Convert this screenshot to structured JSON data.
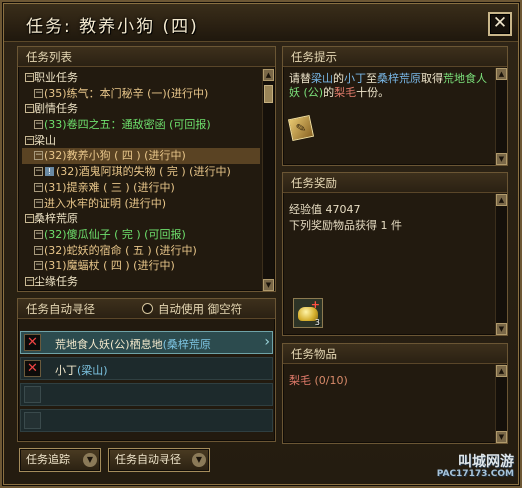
{
  "window": {
    "title": "任务: 教养小狗 (四)",
    "close_label": "✕"
  },
  "quest_list": {
    "header": "任务列表",
    "rows": [
      {
        "kind": "cat",
        "toggle": "−",
        "label": "职业任务"
      },
      {
        "kind": "quest",
        "toggle": "−",
        "label": "(35)练气：本门秘辛 (一)(进行中)",
        "cls": "st-prog"
      },
      {
        "kind": "cat",
        "toggle": "−",
        "label": "剧情任务"
      },
      {
        "kind": "quest",
        "toggle": "−",
        "label": "(33)卷四之五：通敌密函 (可回报)",
        "cls": "st-ret"
      },
      {
        "kind": "cat",
        "toggle": "−",
        "label": "梁山"
      },
      {
        "kind": "quest",
        "toggle": "−",
        "label": "(32)教养小狗 ( 四 ) (进行中)",
        "cls": "st-prog",
        "selected": true
      },
      {
        "kind": "quest",
        "toggle": "−",
        "warn": "!",
        "label": "(32)酒鬼阿琪的失物 ( 完 ) (进行中)",
        "cls": "st-prog"
      },
      {
        "kind": "quest",
        "toggle": "−",
        "label": "(31)提亲难 ( 三 ) (进行中)",
        "cls": "st-prog"
      },
      {
        "kind": "quest",
        "toggle": "−",
        "label": "进入水牢的证明 (进行中)",
        "cls": "st-prog"
      },
      {
        "kind": "cat",
        "toggle": "−",
        "label": "桑梓荒原"
      },
      {
        "kind": "quest",
        "toggle": "−",
        "label": "(32)傻瓜仙子 ( 完 ) (可回报)",
        "cls": "st-ret"
      },
      {
        "kind": "quest",
        "toggle": "−",
        "label": "(32)蛇妖的宿命 ( 五 ) (进行中)",
        "cls": "st-prog"
      },
      {
        "kind": "quest",
        "toggle": "−",
        "label": "(31)魔蝠杖 ( 四 ) (进行中)",
        "cls": "st-prog"
      },
      {
        "kind": "cat",
        "toggle": "−",
        "label": "尘缘任务"
      }
    ]
  },
  "auto_path": {
    "header": "任务自动寻径",
    "checkbox_label": "自动使用  御空符",
    "rows": [
      {
        "icon": "✕",
        "text": "荒地食人妖(公)栖息地",
        "loc": "(桑梓荒原",
        "active": true
      },
      {
        "icon": "✕",
        "text": "小丁",
        "loc": "(梁山)",
        "active": false
      },
      {
        "icon": "",
        "text": "",
        "loc": "",
        "active": false
      },
      {
        "icon": "",
        "text": "",
        "loc": "",
        "active": false
      }
    ],
    "track_button": "任务追踪",
    "auto_button": "任务自动寻径"
  },
  "hint": {
    "header": "任务提示",
    "p1": "请替",
    "p2": "梁山",
    "p3": "的",
    "p4": "小丁",
    "p5": "至",
    "p6": "桑梓荒原",
    "p7": "取得",
    "p8": "荒地食人妖 (公)",
    "p9": "的",
    "p10": "梨毛",
    "p11": "十份。"
  },
  "reward": {
    "header": "任务奖励",
    "exp": "经验值 47047",
    "items_line": "下列奖励物品获得 1 件",
    "slot_count": "3",
    "slot_plus": "+"
  },
  "items": {
    "header": "任务物品",
    "name": "梨毛",
    "count": "(0/10)"
  },
  "watermark": {
    "main": "叫城网游",
    "sub": "PAC17173.COM"
  },
  "colors": {
    "progress": "#e8c68a",
    "returnable": "#6ee06c",
    "location": "#7ec6e4"
  }
}
